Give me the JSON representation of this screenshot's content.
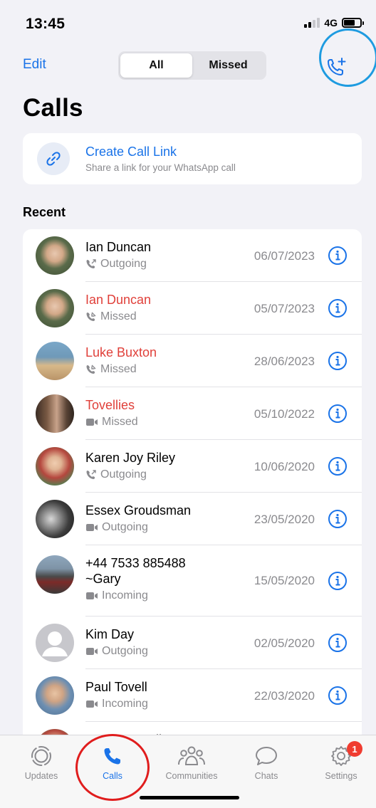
{
  "status": {
    "time": "13:45",
    "network": "4G"
  },
  "header": {
    "edit_label": "Edit",
    "segments": [
      {
        "label": "All",
        "active": true
      },
      {
        "label": "Missed",
        "active": false
      }
    ],
    "title": "Calls",
    "new_call_icon": "phone-plus-icon"
  },
  "call_link": {
    "title": "Create Call Link",
    "subtitle": "Share a link for your WhatsApp call",
    "icon": "link-icon"
  },
  "recent": {
    "header": "Recent",
    "calls": [
      {
        "name": "Ian Duncan",
        "missed": false,
        "kind": "voice",
        "direction": "Outgoing",
        "date": "06/07/2023",
        "avatar": "photo-1"
      },
      {
        "name": "Ian Duncan",
        "missed": true,
        "kind": "voice",
        "direction": "Missed",
        "date": "05/07/2023",
        "avatar": "photo-1"
      },
      {
        "name": "Luke Buxton",
        "missed": true,
        "kind": "voice",
        "direction": "Missed",
        "date": "28/06/2023",
        "avatar": "photo-2"
      },
      {
        "name": "Tovellies",
        "missed": true,
        "kind": "video",
        "direction": "Missed",
        "date": "05/10/2022",
        "avatar": "photo-3"
      },
      {
        "name": "Karen Joy Riley",
        "missed": false,
        "kind": "voice",
        "direction": "Outgoing",
        "date": "10/06/2020",
        "avatar": "photo-4"
      },
      {
        "name": "Essex Groudsman",
        "missed": false,
        "kind": "video",
        "direction": "Outgoing",
        "date": "23/05/2020",
        "avatar": "photo-5"
      },
      {
        "name": "+44 7533 885488",
        "name2": "~Gary",
        "missed": false,
        "kind": "video",
        "direction": "Incoming",
        "date": "15/05/2020",
        "avatar": "photo-6"
      },
      {
        "name": "Kim Day",
        "missed": false,
        "kind": "video",
        "direction": "Outgoing",
        "date": "02/05/2020",
        "avatar": "placeholder"
      },
      {
        "name": "Paul Tovell",
        "missed": false,
        "kind": "video",
        "direction": "Incoming",
        "date": "22/03/2020",
        "avatar": "photo-7"
      },
      {
        "name": "Karen Joy Riley",
        "missed": false,
        "kind": "voice",
        "direction": "",
        "date": "",
        "avatar": "photo-4"
      }
    ]
  },
  "tabbar": {
    "tabs": [
      {
        "label": "Updates",
        "icon": "updates-icon",
        "active": false
      },
      {
        "label": "Calls",
        "icon": "phone-icon",
        "active": true
      },
      {
        "label": "Communities",
        "icon": "communities-icon",
        "active": false
      },
      {
        "label": "Chats",
        "icon": "chat-bubble-icon",
        "active": false
      },
      {
        "label": "Settings",
        "icon": "gear-icon",
        "active": false,
        "badge": "1"
      }
    ]
  },
  "colors": {
    "accent": "#1a73e8",
    "missed": "#e0403a",
    "annotation_blue": "#1e9be0",
    "annotation_red": "#e01d1d",
    "badge": "#f03c30"
  }
}
